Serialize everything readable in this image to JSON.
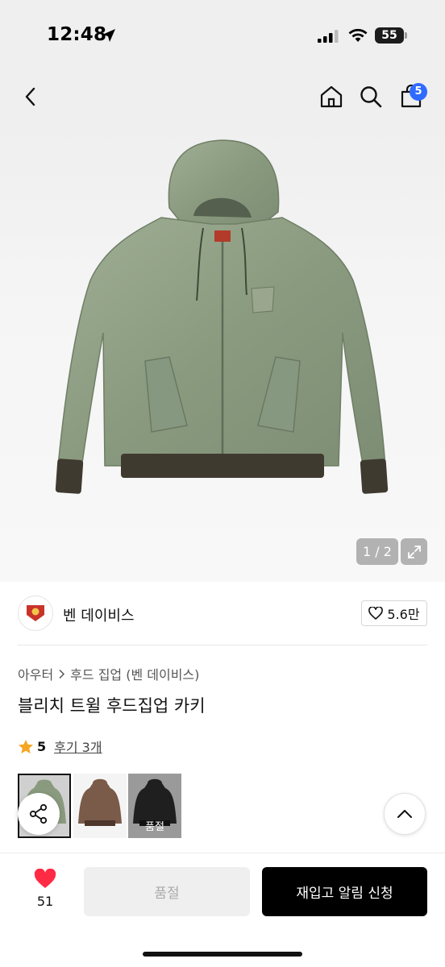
{
  "status_bar": {
    "time": "12:48",
    "battery": "55"
  },
  "nav": {
    "cart_count": "5"
  },
  "gallery": {
    "counter": "1 / 2"
  },
  "brand": {
    "name": "벤 데이비스",
    "likes": "5.6만"
  },
  "breadcrumb": {
    "category": "아우터",
    "subcategory": "후드 집업 (벤 데이비스)"
  },
  "product": {
    "title": "블리치 트윌 후드집업 카키",
    "rating": "5",
    "reviews": "후기 3개"
  },
  "thumbnails": [
    {
      "color": "#8a9a7e",
      "selected": true
    },
    {
      "color": "#7a5a48",
      "selected": false
    },
    {
      "color": "#222222",
      "selected": false,
      "badge": "품절"
    }
  ],
  "bottom_bar": {
    "wish_count": "51",
    "soldout_label": "품절",
    "restock_label": "재입고 알림 신청"
  },
  "colors": {
    "accent": "#2f6bff",
    "heart": "#ff2a44",
    "star": "#f5a623"
  }
}
